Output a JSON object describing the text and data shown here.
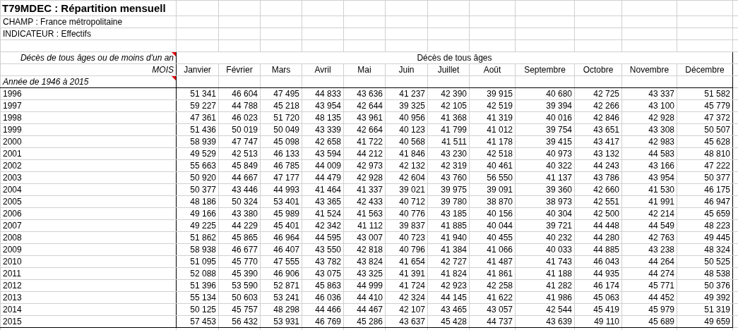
{
  "title": "T79MDEC : Répartition mensuell",
  "meta": [
    "CHAMP : France métropolitaine",
    "INDICATEUR : Effectifs"
  ],
  "table": {
    "corner_top": {
      "text": "Décès de tous âges ou de moins d'un an",
      "has_comment": true
    },
    "group_header": "Décès de tous âges",
    "corner_mois": "MOIS",
    "columns": [
      "Janvier",
      "Février",
      "Mars",
      "Avril",
      "Mai",
      "Juin",
      "Juillet",
      "Août",
      "Septembre",
      "Octobre",
      "Novembre",
      "Décembre"
    ],
    "row_group": {
      "text": "Année de 1946 à 2015",
      "has_comment": true
    },
    "rows": [
      {
        "year": "1996",
        "values": [
          "51 341",
          "46 604",
          "47 495",
          "44 833",
          "43 636",
          "41 237",
          "42 390",
          "39 915",
          "40 680",
          "42 725",
          "43 337",
          "51 582"
        ]
      },
      {
        "year": "1997",
        "values": [
          "59 227",
          "44 788",
          "45 218",
          "43 954",
          "42 644",
          "39 325",
          "42 105",
          "42 519",
          "39 394",
          "42 266",
          "43 100",
          "45 779"
        ]
      },
      {
        "year": "1998",
        "values": [
          "47 361",
          "46 023",
          "51 720",
          "48 135",
          "43 961",
          "40 956",
          "41 368",
          "41 319",
          "40 016",
          "42 846",
          "42 928",
          "47 372"
        ]
      },
      {
        "year": "1999",
        "values": [
          "51 436",
          "50 019",
          "50 049",
          "43 339",
          "42 664",
          "40 123",
          "41 799",
          "41 012",
          "39 754",
          "43 651",
          "43 308",
          "50 507"
        ]
      },
      {
        "year": "2000",
        "values": [
          "58 939",
          "47 747",
          "45 098",
          "42 658",
          "41 722",
          "40 568",
          "41 511",
          "41 178",
          "39 415",
          "43 417",
          "42 983",
          "45 628"
        ]
      },
      {
        "year": "2001",
        "values": [
          "49 529",
          "42 513",
          "46 133",
          "43 594",
          "44 212",
          "41 846",
          "43 230",
          "42 518",
          "40 973",
          "43 132",
          "44 583",
          "48 810"
        ]
      },
      {
        "year": "2002",
        "values": [
          "55 663",
          "45 849",
          "46 785",
          "44 009",
          "42 973",
          "42 132",
          "42 319",
          "40 461",
          "40 322",
          "44 243",
          "43 166",
          "47 222"
        ]
      },
      {
        "year": "2003",
        "values": [
          "50 920",
          "44 667",
          "47 177",
          "44 479",
          "42 928",
          "42 604",
          "43 760",
          "56 550",
          "41 137",
          "43 786",
          "43 954",
          "50 377"
        ]
      },
      {
        "year": "2004",
        "values": [
          "50 377",
          "43 446",
          "44 993",
          "41 464",
          "41 337",
          "39 021",
          "39 975",
          "39 091",
          "39 360",
          "42 660",
          "41 530",
          "46 175"
        ]
      },
      {
        "year": "2005",
        "values": [
          "48 186",
          "50 324",
          "53 401",
          "43 365",
          "42 433",
          "40 712",
          "39 780",
          "38 870",
          "38 973",
          "42 551",
          "41 991",
          "46 947"
        ]
      },
      {
        "year": "2006",
        "values": [
          "49 166",
          "43 380",
          "45 989",
          "41 524",
          "41 563",
          "40 776",
          "43 185",
          "40 156",
          "40 304",
          "42 500",
          "42 214",
          "45 659"
        ]
      },
      {
        "year": "2007",
        "values": [
          "49 225",
          "44 229",
          "45 401",
          "42 342",
          "41 112",
          "39 837",
          "41 885",
          "40 044",
          "39 721",
          "44 448",
          "44 549",
          "48 223"
        ]
      },
      {
        "year": "2008",
        "values": [
          "51 862",
          "45 865",
          "46 964",
          "44 595",
          "43 007",
          "40 723",
          "41 940",
          "40 455",
          "40 232",
          "44 280",
          "42 763",
          "49 445"
        ]
      },
      {
        "year": "2009",
        "values": [
          "58 938",
          "46 677",
          "46 407",
          "43 550",
          "42 818",
          "40 796",
          "41 384",
          "41 066",
          "40 033",
          "44 885",
          "43 238",
          "48 324"
        ]
      },
      {
        "year": "2010",
        "values": [
          "51 095",
          "45 770",
          "47 555",
          "43 782",
          "43 824",
          "41 654",
          "42 727",
          "41 487",
          "41 743",
          "46 043",
          "44 264",
          "50 525"
        ]
      },
      {
        "year": "2011",
        "values": [
          "52 088",
          "45 390",
          "46 906",
          "43 075",
          "43 325",
          "41 391",
          "41 824",
          "41 861",
          "41 188",
          "44 935",
          "44 274",
          "48 538"
        ]
      },
      {
        "year": "2012",
        "values": [
          "51 396",
          "53 590",
          "52 871",
          "45 863",
          "44 999",
          "41 724",
          "42 923",
          "42 258",
          "41 282",
          "46 174",
          "45 771",
          "50 376"
        ]
      },
      {
        "year": "2013",
        "values": [
          "55 134",
          "50 603",
          "53 241",
          "46 036",
          "44 410",
          "42 324",
          "44 145",
          "41 622",
          "41 986",
          "45 063",
          "44 452",
          "49 392"
        ]
      },
      {
        "year": "2014",
        "values": [
          "50 125",
          "45 757",
          "48 298",
          "44 466",
          "44 467",
          "42 107",
          "43 465",
          "43 057",
          "42 544",
          "45 419",
          "45 979",
          "51 319"
        ]
      },
      {
        "year": "2015",
        "values": [
          "57 453",
          "56 432",
          "53 931",
          "46 769",
          "45 286",
          "43 637",
          "45 428",
          "44 737",
          "43 639",
          "49 110",
          "45 689",
          "49 659"
        ]
      }
    ]
  }
}
